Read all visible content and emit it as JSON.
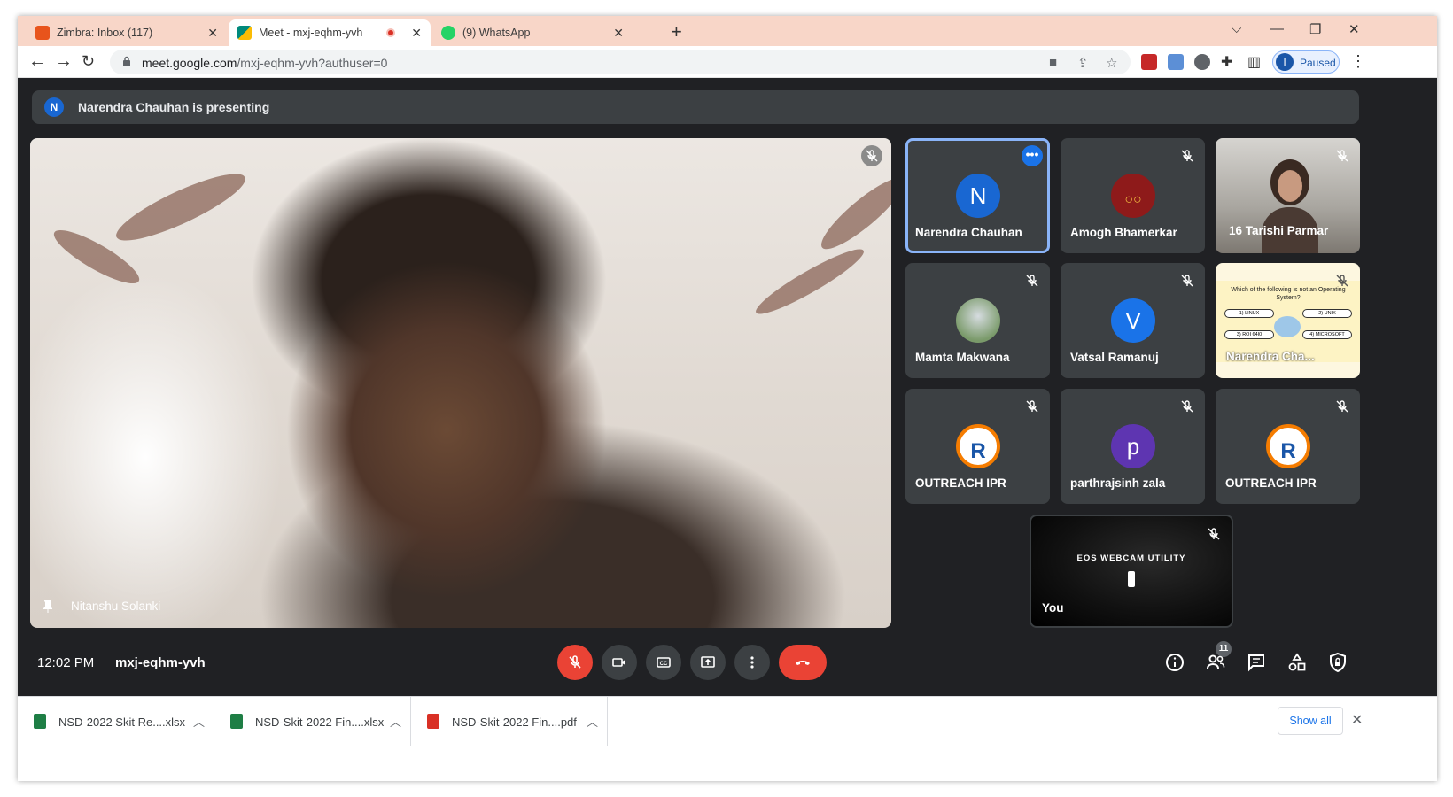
{
  "browser": {
    "tabs": [
      {
        "title": "Zimbra: Inbox (117)",
        "favicon_color": "#e8541c"
      },
      {
        "title": "Meet - mxj-eqhm-yvh",
        "favicon_color": "#00897b",
        "active": true,
        "recording": true
      },
      {
        "title": "(9) WhatsApp",
        "favicon_color": "#25d366"
      }
    ],
    "new_tab": "+",
    "url_host": "meet.google.com",
    "url_path": "/mxj-eqhm-yvh?authuser=0",
    "profile_initial": "I",
    "profile_label": "Paused"
  },
  "meet": {
    "presenting_initial": "N",
    "presenting_text": "Narendra Chauhan is presenting",
    "main_speaker": "Nitanshu Solanki",
    "participants": [
      {
        "name": "Narendra Chauhan",
        "initial": "N",
        "color": "#1967d2",
        "speaking": true
      },
      {
        "name": "Amogh Bhamerkar",
        "initial": "",
        "color": "#8e1a1a"
      },
      {
        "name": "16 Tarishi Parmar",
        "initial": "",
        "color": ""
      },
      {
        "name": "Mamta Makwana",
        "initial": "",
        "color": "#7a9a6a"
      },
      {
        "name": "Vatsal Ramanuj",
        "initial": "V",
        "color": "#1a73e8"
      },
      {
        "name": "Narendra Cha...",
        "initial": "",
        "color": ""
      },
      {
        "name": "OUTREACH IPR",
        "initial": "",
        "color": "#ffffff"
      },
      {
        "name": "parthrajsinh zala",
        "initial": "p",
        "color": "#5e35b1"
      },
      {
        "name": "OUTREACH IPR",
        "initial": "",
        "color": "#ffffff"
      }
    ],
    "self_tile": {
      "name": "You",
      "caption": "EOS WEBCAM UTILITY"
    },
    "slide": {
      "question": "Which of the following is not an Operating System?",
      "options": [
        "1) LINUX",
        "2) UNIX",
        "3) ROI 64I0",
        "4) MICROSOFT"
      ]
    },
    "clock": "12:02 PM",
    "meeting_code": "mxj-eqhm-yvh",
    "participant_count": "11",
    "colors": {
      "end_call": "#ea4335",
      "accent": "#8ab4f8"
    }
  },
  "downloads": {
    "items": [
      {
        "name": "NSD-2022 Skit Re....xlsx",
        "type": "xlsx"
      },
      {
        "name": "NSD-Skit-2022 Fin....xlsx",
        "type": "xlsx"
      },
      {
        "name": "NSD-Skit-2022 Fin....pdf",
        "type": "pdf"
      }
    ],
    "show_all": "Show all"
  }
}
